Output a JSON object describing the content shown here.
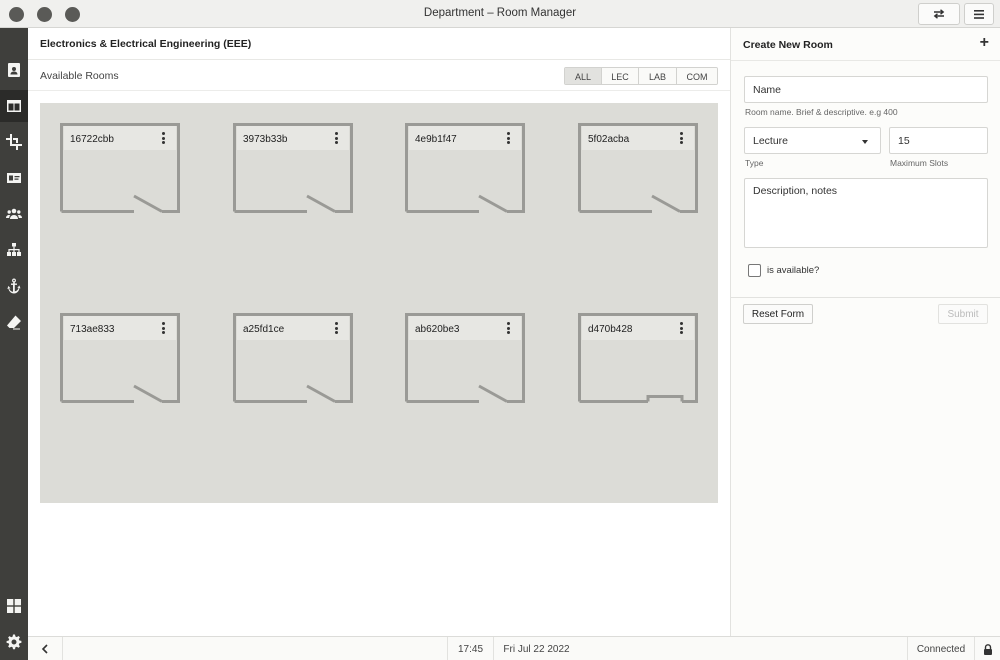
{
  "window": {
    "title": "Department – Room Manager"
  },
  "titlebar": {
    "swap_icon": "swap-icon",
    "menu_icon": "hamburger-icon"
  },
  "sidebar": {
    "items": [
      {
        "name": "sidebar-item-contacts",
        "icon": "contact-book-icon",
        "active": false
      },
      {
        "name": "sidebar-item-layout",
        "icon": "columns-icon",
        "active": true
      },
      {
        "name": "sidebar-item-crop",
        "icon": "crop-icon",
        "active": false
      },
      {
        "name": "sidebar-item-idcard",
        "icon": "id-card-icon",
        "active": false
      },
      {
        "name": "sidebar-item-users",
        "icon": "users-icon",
        "active": false
      },
      {
        "name": "sidebar-item-hierarchy",
        "icon": "sitemap-icon",
        "active": false
      },
      {
        "name": "sidebar-item-anchor",
        "icon": "anchor-icon",
        "active": false
      },
      {
        "name": "sidebar-item-eraser",
        "icon": "eraser-icon",
        "active": false
      },
      {
        "name": "sidebar-item-dashboard",
        "icon": "dashboard-icon",
        "active": false
      },
      {
        "name": "sidebar-item-settings",
        "icon": "gear-icon",
        "active": false
      }
    ]
  },
  "main": {
    "department": "Electronics & Electrical Engineering (EEE)",
    "available_label": "Available Rooms",
    "filters": [
      "ALL",
      "LEC",
      "LAB",
      "COM"
    ],
    "active_filter": "ALL",
    "rooms": [
      {
        "id": "16722cbb",
        "door": "swing"
      },
      {
        "id": "3973b33b",
        "door": "swing"
      },
      {
        "id": "4e9b1f47",
        "door": "swing"
      },
      {
        "id": "5f02acba",
        "door": "swing"
      },
      {
        "id": "713ae833",
        "door": "swing"
      },
      {
        "id": "a25fd1ce",
        "door": "swing"
      },
      {
        "id": "ab620be3",
        "door": "swing"
      },
      {
        "id": "d470b428",
        "door": "sliding"
      }
    ]
  },
  "panel": {
    "title": "Create New Room",
    "add_icon": "plus-icon",
    "name_value": "Name",
    "name_hint": "Room name. Brief & descriptive. e.g 400",
    "type_value": "Lecture",
    "type_hint": "Type",
    "slots_value": "15",
    "slots_hint": "Maximum Slots",
    "description_value": "Description, notes",
    "available_label": "is available?",
    "reset_label": "Reset Form",
    "submit_label": "Submit"
  },
  "statusbar": {
    "back_icon": "chevron-left-icon",
    "time": "17:45",
    "date": "Fri Jul 22 2022",
    "connection": "Connected",
    "lock_icon": "lock-icon"
  }
}
